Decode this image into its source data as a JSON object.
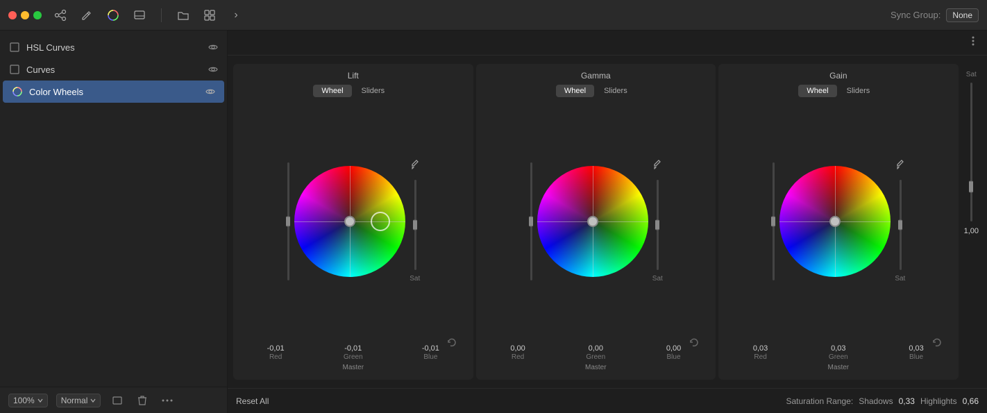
{
  "titlebar": {
    "sync_label": "Sync Group:",
    "sync_value": "None"
  },
  "toolbar": {
    "icons": [
      "⊞",
      "✎",
      "◎",
      "▣",
      "›"
    ]
  },
  "sidebar": {
    "items": [
      {
        "id": "hsl-curves",
        "label": "HSL Curves",
        "active": false
      },
      {
        "id": "curves",
        "label": "Curves",
        "active": false
      },
      {
        "id": "color-wheels",
        "label": "Color Wheels",
        "active": true
      }
    ]
  },
  "wheels": [
    {
      "id": "lift",
      "title": "Lift",
      "tab_active": "Wheel",
      "tabs": [
        "Wheel",
        "Sliders"
      ],
      "values": {
        "red": "-0,01",
        "green": "-0,01",
        "blue": "-0,01"
      },
      "master_label": "Master",
      "sat_label": "Sat",
      "reset_visible": true,
      "cursor_overlay": true
    },
    {
      "id": "gamma",
      "title": "Gamma",
      "tab_active": "Wheel",
      "tabs": [
        "Wheel",
        "Sliders"
      ],
      "values": {
        "red": "0,00",
        "green": "0,00",
        "blue": "0,00"
      },
      "master_label": "Master",
      "sat_label": "Sat",
      "reset_visible": true,
      "cursor_overlay": false
    },
    {
      "id": "gain",
      "title": "Gain",
      "tab_active": "Wheel",
      "tabs": [
        "Wheel",
        "Sliders"
      ],
      "values": {
        "red": "0,03",
        "green": "0,03",
        "blue": "0,03"
      },
      "master_label": "Master",
      "sat_label": "Sat",
      "reset_visible": true,
      "cursor_overlay": false
    }
  ],
  "far_sat": {
    "label": "Sat",
    "value": "1,00"
  },
  "content_bottom": {
    "reset_all": "Reset All"
  },
  "saturation_range": {
    "label": "Saturation Range:",
    "shadows_label": "Shadows",
    "shadows_value": "0,33",
    "highlights_label": "Highlights",
    "highlights_value": "0,66"
  },
  "bottom_bar": {
    "zoom": "100%",
    "mode": "Normal"
  },
  "labels": {
    "red": "Red",
    "green": "Green",
    "blue": "Blue"
  }
}
